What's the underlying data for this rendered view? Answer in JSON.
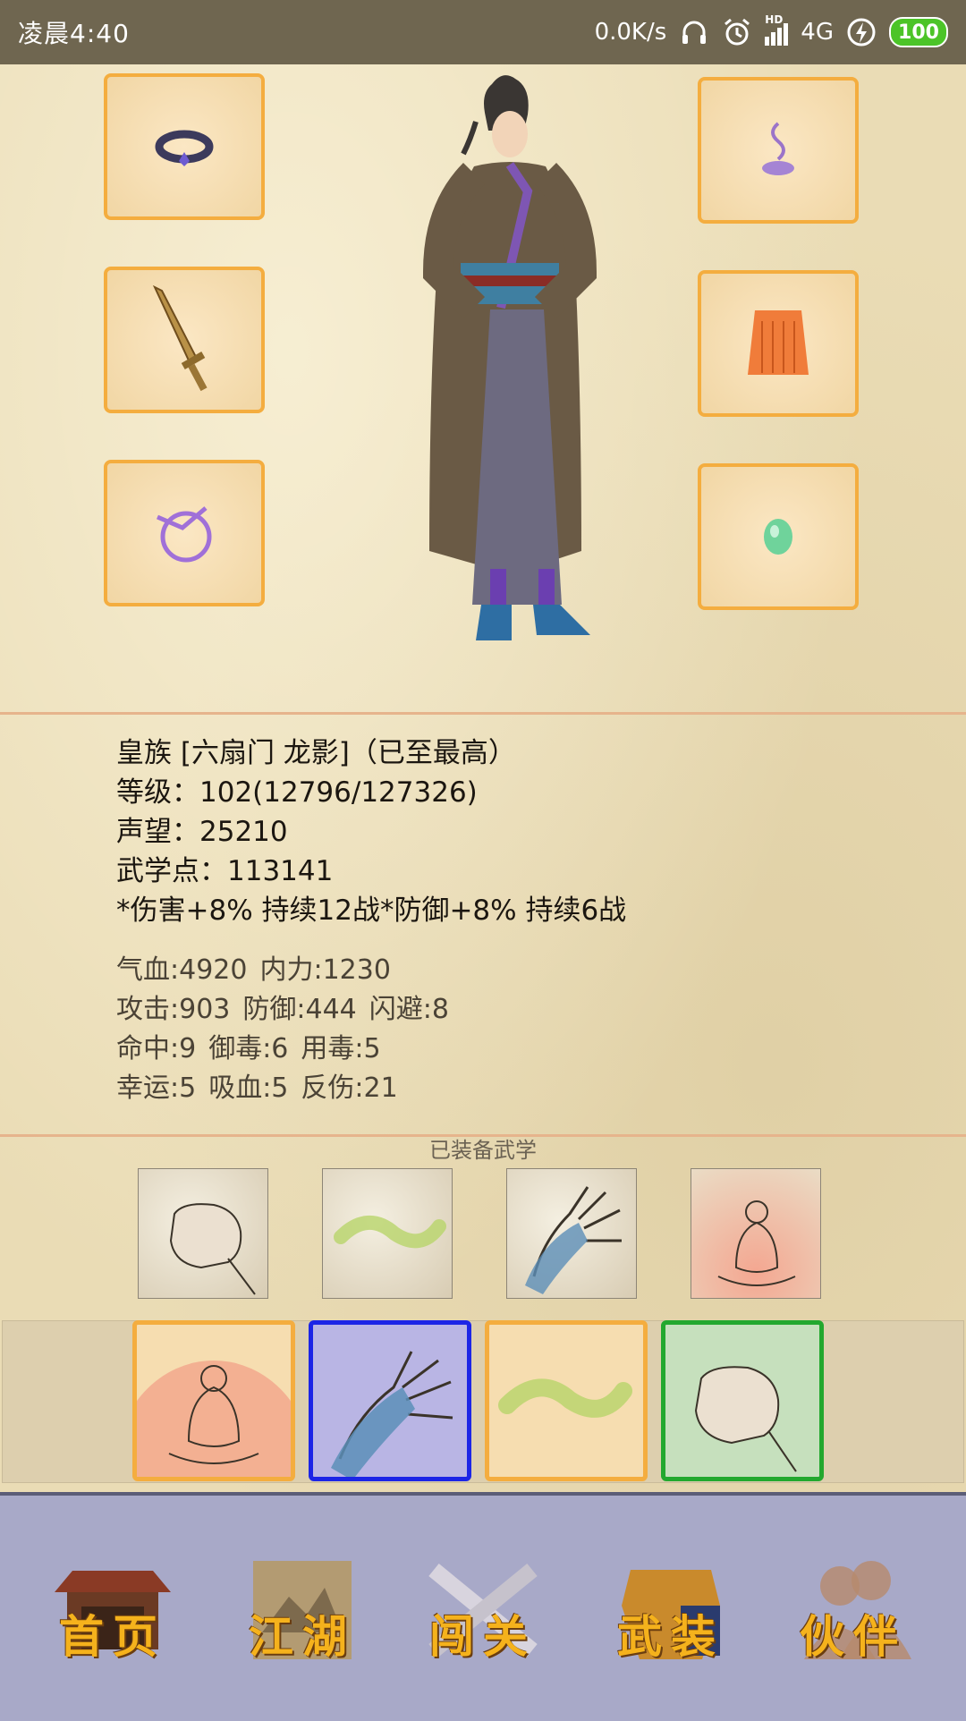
{
  "status_bar": {
    "time": "凌晨4:40",
    "network_speed": "0.0K/s",
    "network_type": "4G",
    "hd_label": "HD",
    "battery": "100",
    "battery_color": "#4cc428"
  },
  "equipment": {
    "left_slots": [
      "bracelet-icon",
      "sword-icon",
      "ribbon-ring-icon"
    ],
    "right_slots": [
      "incense-icon",
      "cloak-icon",
      "jade-icon"
    ],
    "slot_border_color": "#f4ad3f"
  },
  "character_info": {
    "title_line": "皇族 [六扇门 龙影]（已至最高）",
    "level_line": "等级：102(12796/127326)",
    "reputation_line": "声望：25210",
    "martial_points_line": "武学点：113141",
    "buff_line": "*伤害+8% 持续12战*防御+8% 持续6战"
  },
  "stats": {
    "row1": [
      "气血:4920",
      "内力:1230"
    ],
    "row2": [
      "攻击:903",
      "防御:444",
      "闪避:8"
    ],
    "row3": [
      "命中:9",
      "御毒:6",
      "用毒:5"
    ],
    "row4": [
      "幸运:5",
      "吸血:5",
      "反伤:21"
    ]
  },
  "equipped_skills": {
    "title": "已装备武学",
    "icons": [
      "fist-icon",
      "vine-icon",
      "claw-hand-icon",
      "meditation-icon"
    ]
  },
  "skill_bar": {
    "slots": [
      {
        "icon": "meditation-icon",
        "border": "orange"
      },
      {
        "icon": "claw-hand-icon",
        "border": "blue"
      },
      {
        "icon": "vine-icon",
        "border": "orange"
      },
      {
        "icon": "fist-icon",
        "border": "green"
      }
    ]
  },
  "nav": {
    "items": [
      {
        "label": "首页",
        "icon": "house-icon"
      },
      {
        "label": "江湖",
        "icon": "scroll-map-icon"
      },
      {
        "label": "闯关",
        "icon": "crossed-swords-icon"
      },
      {
        "label": "武装",
        "icon": "armor-icon"
      },
      {
        "label": "伙伴",
        "icon": "companions-icon"
      }
    ]
  }
}
